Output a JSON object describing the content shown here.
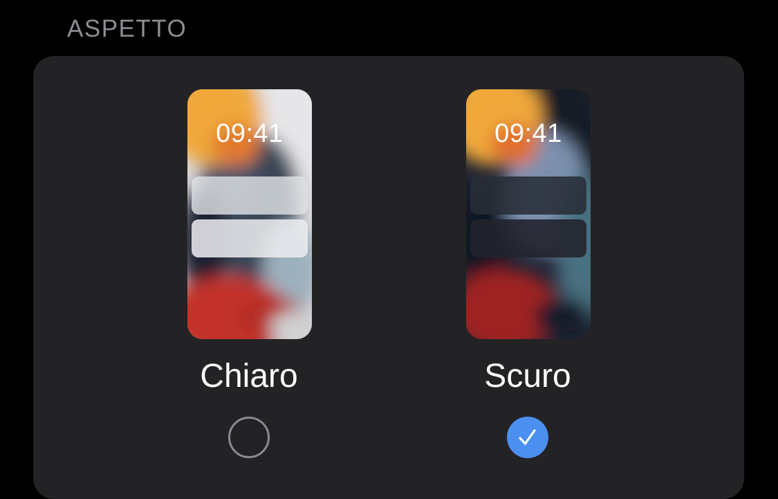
{
  "section": {
    "header": "ASPETTO"
  },
  "appearance": {
    "options": [
      {
        "label": "Chiaro",
        "preview_time": "09:41",
        "selected": false
      },
      {
        "label": "Scuro",
        "preview_time": "09:41",
        "selected": true
      }
    ]
  },
  "colors": {
    "background": "#000000",
    "card": "#232325",
    "accent": "#4b8ff0",
    "header_text": "#8d8d93",
    "radio_border": "#8b8b90"
  },
  "icons": {
    "selected_indicator": "checkmark-icon",
    "unselected_indicator": "empty-circle"
  }
}
